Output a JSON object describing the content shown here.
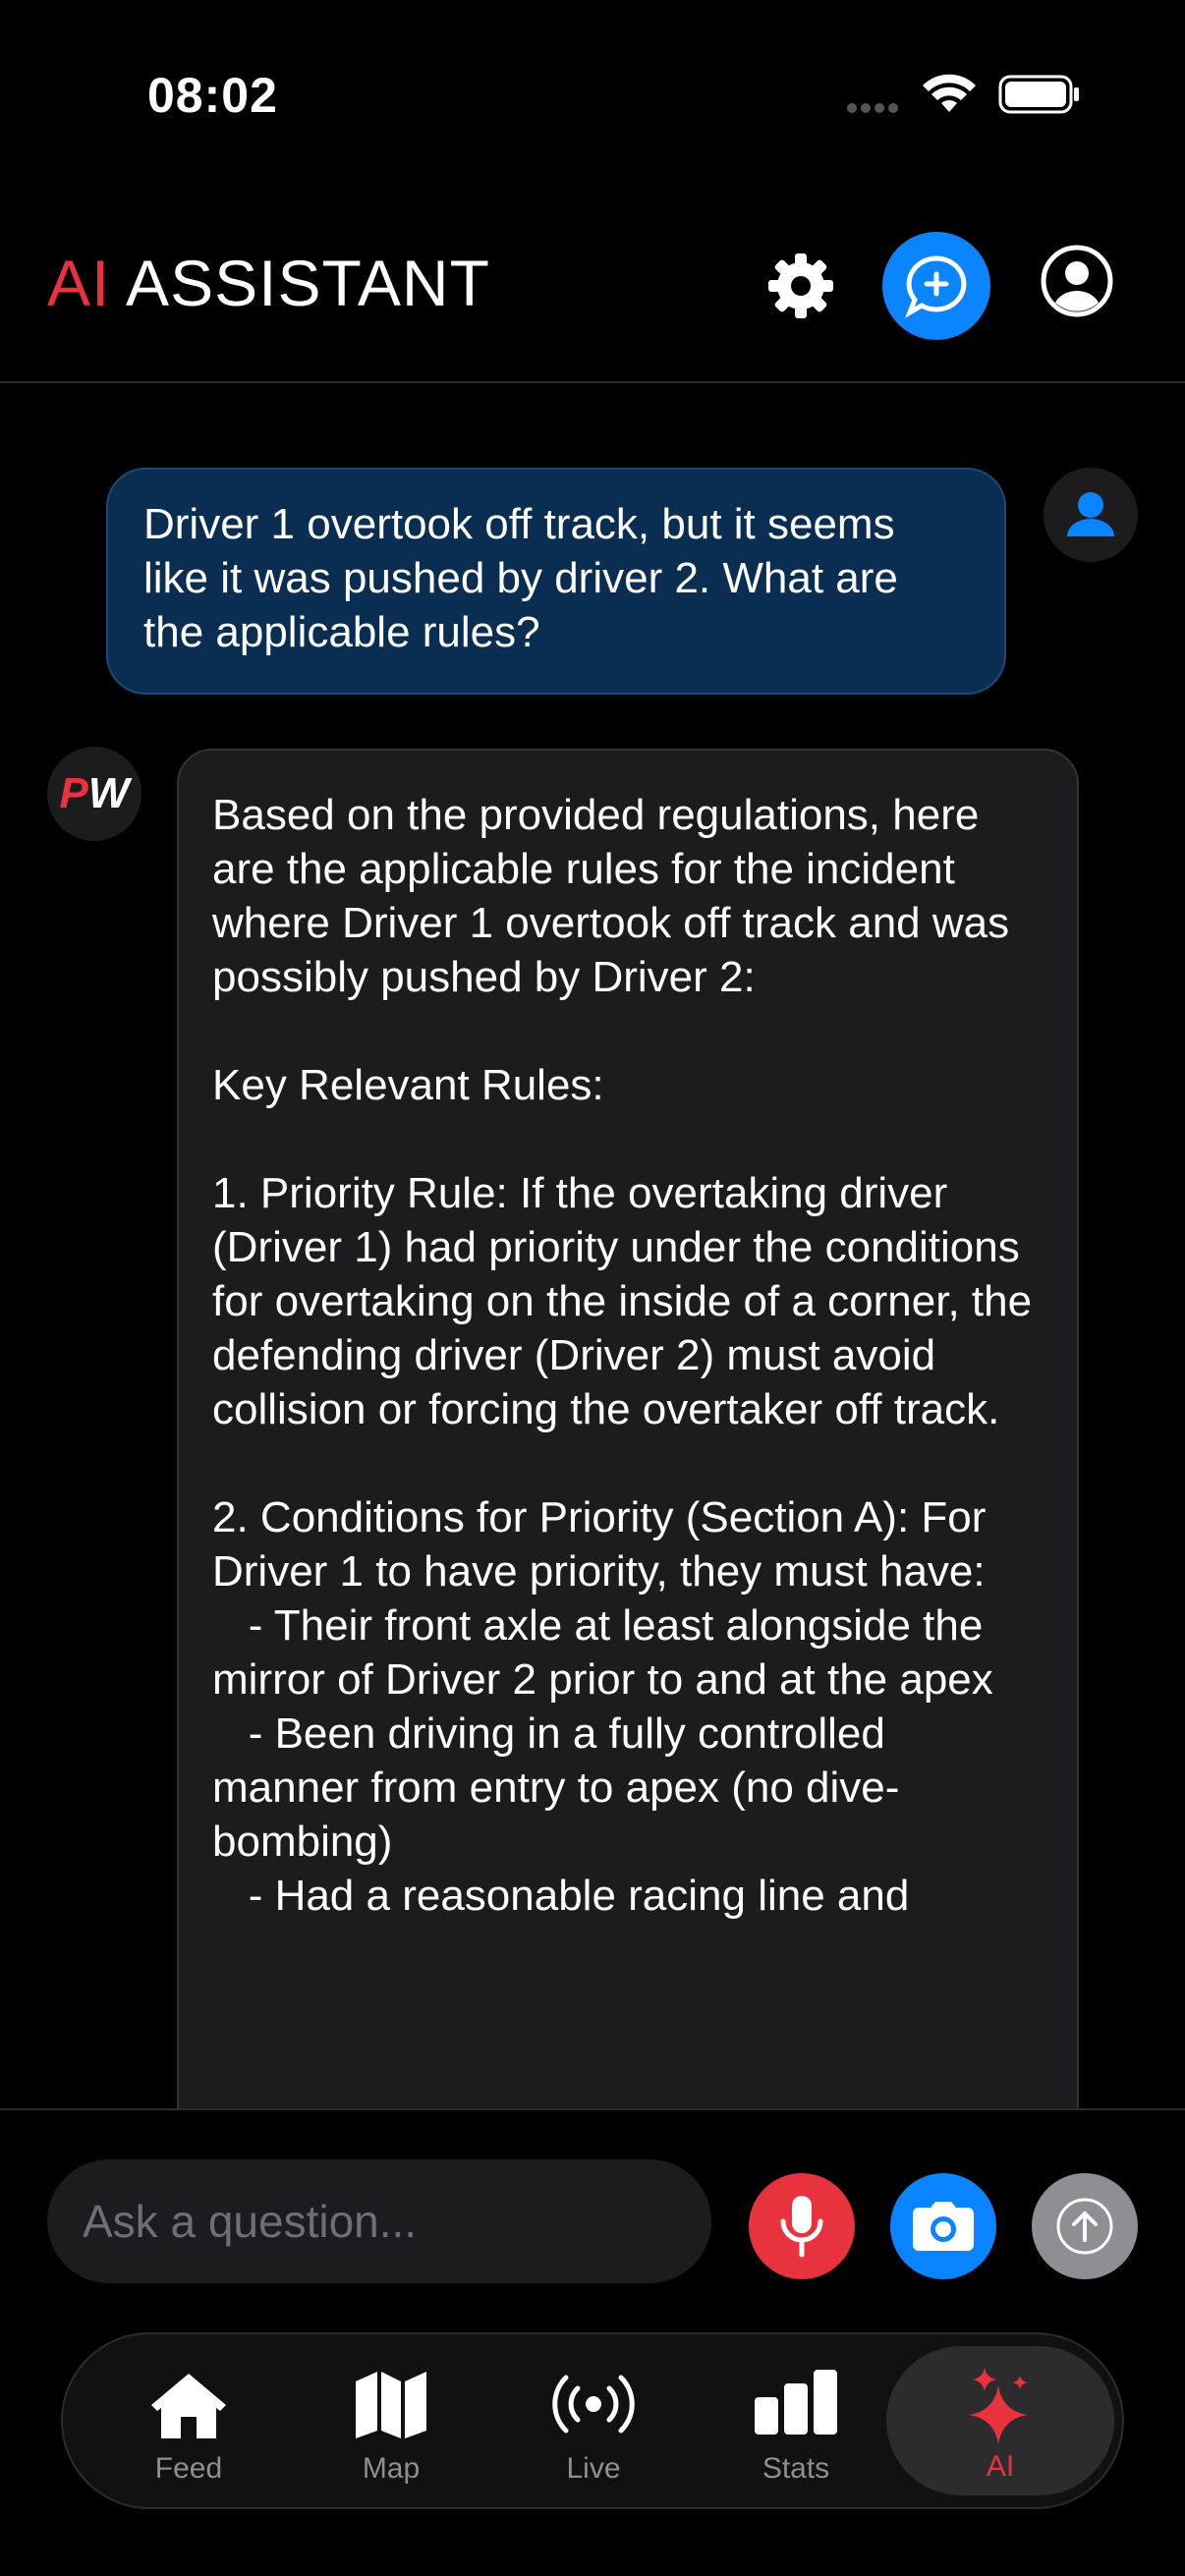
{
  "status_bar": {
    "time": "08:02"
  },
  "header": {
    "title_accent": "AI",
    "title_rest": " ASSISTANT"
  },
  "chat": {
    "user_message": "Driver 1 overtook off track, but it seems like it was pushed by driver 2. What are the applicable rules?",
    "bot_avatar_p": "P",
    "bot_avatar_w": "W",
    "bot_message": "Based on the provided regulations, here are the applicable rules for the incident where Driver 1 overtook off track and was possibly pushed by Driver 2:\n\nKey Relevant Rules:\n\n1. Priority Rule: If the overtaking driver (Driver 1) had priority under the conditions for overtaking on the inside of a corner, the defending driver (Driver 2) must avoid collision or forcing the overtaker off track.\n\n2. Conditions for Priority (Section A): For Driver 1 to have priority, they must have:\n   - Their front axle at least alongside the mirror of Driver 2 prior to and at the apex\n   - Been driving in a fully controlled manner from entry to apex (no dive-bombing)\n   - Had a reasonable racing line and"
  },
  "input_bar": {
    "placeholder": "Ask a question..."
  },
  "tabs": [
    {
      "label": "Feed",
      "icon": "house-icon"
    },
    {
      "label": "Map",
      "icon": "map-icon"
    },
    {
      "label": "Live",
      "icon": "broadcast-icon"
    },
    {
      "label": "Stats",
      "icon": "bar-chart-icon"
    },
    {
      "label": "AI",
      "icon": "sparkles-icon",
      "active": true
    }
  ],
  "colors": {
    "accent_red": "#e8333f",
    "accent_blue": "#0a84ff",
    "user_bubble": "#0a2e52",
    "bot_bubble": "#1c1c1e"
  }
}
